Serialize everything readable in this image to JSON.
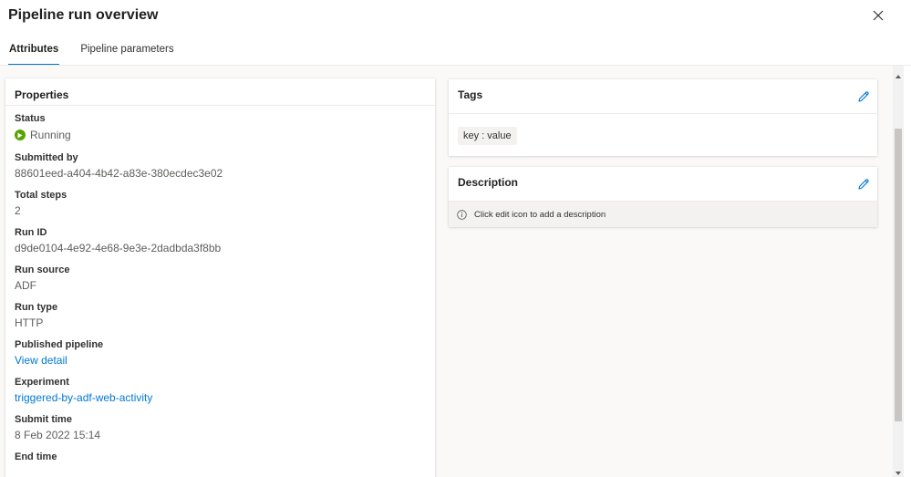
{
  "panel": {
    "title": "Pipeline run overview"
  },
  "tabs": [
    {
      "label": "Attributes",
      "active": true
    },
    {
      "label": "Pipeline parameters",
      "active": false
    }
  ],
  "properties": {
    "header": "Properties",
    "status_label": "Status",
    "status_value": "Running",
    "submitted_by_label": "Submitted by",
    "submitted_by_value": "88601eed-a404-4b42-a83e-380ecdec3e02",
    "total_steps_label": "Total steps",
    "total_steps_value": "2",
    "run_id_label": "Run ID",
    "run_id_value": "d9de0104-4e92-4e68-9e3e-2dadbda3f8bb",
    "run_source_label": "Run source",
    "run_source_value": "ADF",
    "run_type_label": "Run type",
    "run_type_value": "HTTP",
    "published_pipeline_label": "Published pipeline",
    "published_pipeline_link": "View detail",
    "experiment_label": "Experiment",
    "experiment_link": "triggered-by-adf-web-activity",
    "submit_time_label": "Submit time",
    "submit_time_value": "8 Feb 2022 15:14",
    "end_time_label": "End time"
  },
  "tags": {
    "header": "Tags",
    "items": [
      "key : value"
    ]
  },
  "description": {
    "header": "Description",
    "info": "Click edit icon to add a description"
  },
  "colors": {
    "accent": "#0078d4",
    "status_running": "#57a300"
  },
  "icons": {
    "close": "close-icon",
    "edit": "edit-pencil-icon",
    "info": "info-icon",
    "status": "play-circle-icon"
  }
}
